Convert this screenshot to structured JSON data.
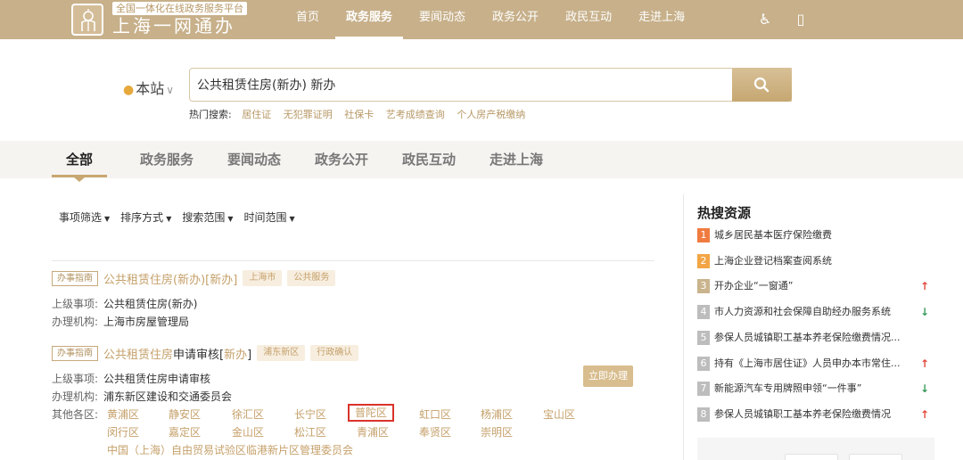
{
  "header": {
    "tagline": "全国一体化在线政务服务平台",
    "brand": "上海一网通办",
    "nav": [
      "首页",
      "政务服务",
      "要闻动态",
      "政务公开",
      "政民互动",
      "走进上海"
    ],
    "active_nav": "政务服务",
    "accessibility_icon": "♿",
    "mobile_icon": "▯"
  },
  "search": {
    "location": "本站",
    "query": "公共租赁住房(新办) 新办",
    "hot_label": "热门搜索:",
    "hot_keywords": [
      "居住证",
      "无犯罪证明",
      "社保卡",
      "艺考成绩查询",
      "个人房产税缴纳"
    ]
  },
  "tabs": [
    "全部",
    "政务服务",
    "要闻动态",
    "政务公开",
    "政民互动",
    "走进上海"
  ],
  "filters": [
    "事项筛选",
    "排序方式",
    "搜索范围",
    "时间范围"
  ],
  "results": [
    {
      "badge": "办事指南",
      "title_pre": "公共租赁住房(",
      "title_kw1": "新办",
      "title_mid": ")[",
      "title_kw2": "新办",
      "title_end": "]",
      "tags": [
        "上海市",
        "公共服务"
      ],
      "parent_label": "上级事项:",
      "parent_value": "公共租赁住房(新办)",
      "org_label": "办理机构:",
      "org_value": "上海市房屋管理局"
    },
    {
      "badge": "办事指南",
      "title_pre": "公共租赁住房",
      "title_dark": "申请审核",
      "title_mid": "[",
      "title_kw2": "新办",
      "title_end": "]",
      "tags": [
        "浦东新区",
        "行政确认"
      ],
      "parent_label": "上级事项:",
      "parent_value": "公共租赁住房申请审核",
      "org_label": "办理机构:",
      "org_value": "浦东新区建设和交通委员会",
      "action": "立即办理",
      "district_label": "其他各区:",
      "districts_row1": [
        "黄浦区",
        "静安区",
        "徐汇区",
        "长宁区",
        "普陀区",
        "虹口区",
        "杨浦区",
        "宝山区"
      ],
      "districts_row2": [
        "闵行区",
        "嘉定区",
        "金山区",
        "松江区",
        "青浦区",
        "奉贤区",
        "崇明区"
      ],
      "districts_row3": [
        "中国（上海）自由贸易试验区临港新片区管理委员会"
      ],
      "highlighted": "普陀区"
    }
  ],
  "sidebar": {
    "title": "热搜资源",
    "items": [
      {
        "n": "1",
        "text": "城乡居民基本医疗保险缴费",
        "trend": "",
        "color": "#f07b3f"
      },
      {
        "n": "2",
        "text": "上海企业登记档案查阅系统",
        "trend": "",
        "color": "#f3a545"
      },
      {
        "n": "3",
        "text": "开办企业“一窗通”",
        "trend": "up",
        "color": "#c9b48d"
      },
      {
        "n": "4",
        "text": "市人力资源和社会保障自助经办服务系统",
        "trend": "down",
        "color": "#bdbdbd"
      },
      {
        "n": "5",
        "text": "参保人员城镇职工基本养老保险缴费情况...",
        "trend": "",
        "color": "#bdbdbd"
      },
      {
        "n": "6",
        "text": "持有《上海市居住证》人员申办本市常住...",
        "trend": "up",
        "color": "#bdbdbd"
      },
      {
        "n": "7",
        "text": "新能源汽车专用牌照申领“一件事”",
        "trend": "down",
        "color": "#bdbdbd"
      },
      {
        "n": "8",
        "text": "参保人员城镇职工基本养老保险缴费情况",
        "trend": "up",
        "color": "#bdbdbd"
      }
    ],
    "up_symbol": "↑",
    "down_symbol": "↓"
  },
  "colors": {
    "brand": "#c7b08a",
    "accent": "#c5a06a",
    "highlight_border": "#d9332b"
  }
}
